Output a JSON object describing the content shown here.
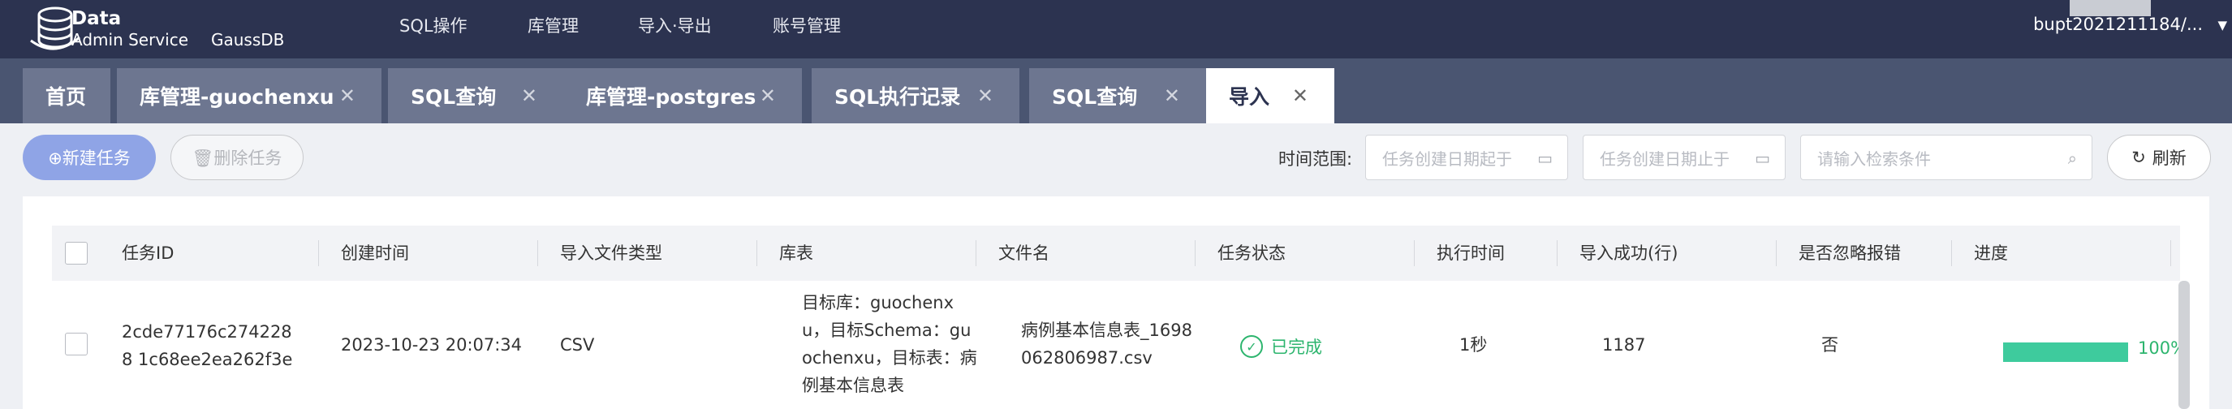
{
  "app": {
    "title": "Data",
    "subtitle": "Admin Service",
    "product": "GaussDB"
  },
  "menu": [
    "SQL操作",
    "库管理",
    "导入·导出",
    "账号管理"
  ],
  "user": {
    "name": "bupt2021211184/..."
  },
  "tabs": [
    {
      "label": "首页",
      "closable": false
    },
    {
      "label": "库管理-guochenxu",
      "closable": true
    },
    {
      "label": "SQL查询",
      "closable": true
    },
    {
      "label": "库管理-postgres",
      "closable": true
    },
    {
      "label": "SQL执行记录",
      "closable": true
    },
    {
      "label": "SQL查询",
      "closable": true
    },
    {
      "label": "导入",
      "closable": true,
      "active": true
    }
  ],
  "toolbar": {
    "new_task": "⊕新建任务",
    "delete_task": "🗑删除任务",
    "time_range_label": "时间范围:",
    "start_placeholder": "任务创建日期起于",
    "end_placeholder": "任务创建日期止于",
    "search_placeholder": "请输入检索条件",
    "refresh": "刷新"
  },
  "table": {
    "columns": [
      "任务ID",
      "创建时间",
      "导入文件类型",
      "库表",
      "文件名",
      "任务状态",
      "执行时间",
      "导入成功(行)",
      "是否忽略报错",
      "进度"
    ],
    "rows": [
      {
        "task_id": "2cde77176c2742288 1c68ee2ea262f3e",
        "created": "2023-10-23 20:07:34",
        "file_type": "CSV",
        "db_table": "目标库：guochenxu，目标Schema：guochenxu，目标表：病例基本信息表",
        "file_name": "病例基本信息表_1698062806987.csv",
        "status": "已完成",
        "exec_time": "1秒",
        "success_rows": "1187",
        "ignore_errors": "否",
        "progress_label": "100%",
        "progress": 1.0
      }
    ]
  },
  "colors": {
    "nav_bg": "#2c3350",
    "tabbar_bg": "#4a5571",
    "accent": "#8fa4e6",
    "success": "#2db56e",
    "progress": "#3ecb9d"
  }
}
